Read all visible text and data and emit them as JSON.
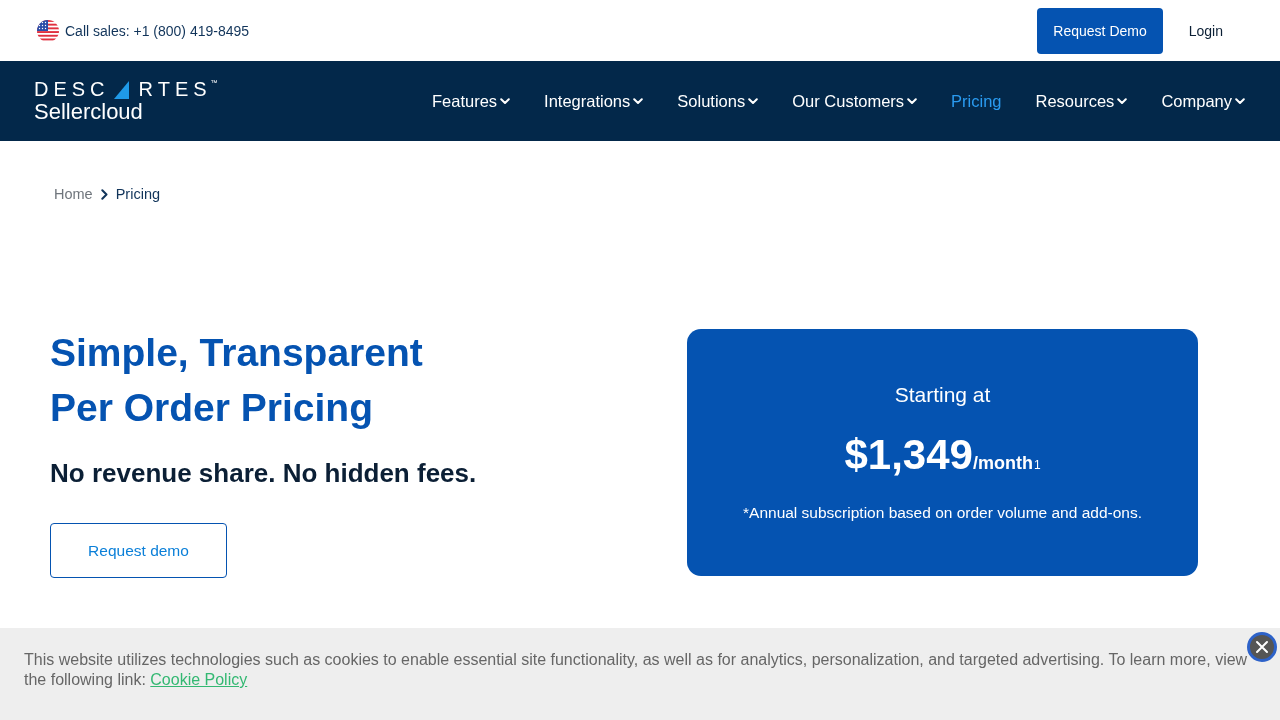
{
  "top_bar": {
    "phone": "Call sales: +1 (800) 419-8495",
    "buttons": [
      {
        "label": "Request Demo",
        "kind": "filled"
      },
      {
        "label": "Login",
        "kind": "text"
      }
    ]
  },
  "logo": {
    "left": "DESC",
    "right": "RTES",
    "mark": "™",
    "product": "Sellercloud"
  },
  "nav": {
    "items": [
      {
        "label": "Features",
        "has_menu": true,
        "selected": false
      },
      {
        "label": "Integrations",
        "has_menu": true,
        "selected": false
      },
      {
        "label": "Solutions",
        "has_menu": true,
        "selected": false
      },
      {
        "label": "Our Customers",
        "has_menu": true,
        "selected": false
      },
      {
        "label": "Pricing",
        "has_menu": false,
        "selected": true
      },
      {
        "label": "Resources",
        "has_menu": true,
        "selected": false
      },
      {
        "label": "Company",
        "has_menu": true,
        "selected": false
      }
    ]
  },
  "breadcrumb": [
    {
      "label": "Home",
      "selected": false
    },
    {
      "label": "Pricing",
      "selected": true
    }
  ],
  "hero": {
    "title_lines": [
      "Simple, Transparent",
      "Per Order Pricing"
    ],
    "subtitle": "No revenue share. No hidden fees.",
    "button": "Request demo"
  },
  "price_card": {
    "lead": "Starting at",
    "price": "$1,349",
    "period": "/month",
    "footnote_mark": "1",
    "note": "*Annual subscription based on order volume and add-ons."
  },
  "cookie_banner": {
    "text": "This website utilizes technologies such as cookies to enable essential site functionality, as well as for analytics, personalization, and targeted advertising. To learn more, view the following link:",
    "link": "Cookie Policy"
  }
}
